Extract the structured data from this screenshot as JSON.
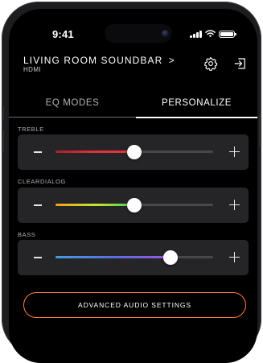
{
  "status_bar": {
    "time": "9:41",
    "icons": [
      "signal-icon",
      "wifi-icon",
      "battery-icon"
    ]
  },
  "header": {
    "device_name": "LIVING ROOM SOUNDBAR",
    "chevron": ">",
    "source": "HDMI",
    "icons": [
      "gear-icon",
      "exit-icon"
    ]
  },
  "tabs": [
    {
      "label": "EQ MODES",
      "active": false
    },
    {
      "label": "PERSONALIZE",
      "active": true
    }
  ],
  "sliders": [
    {
      "label": "TREBLE",
      "level": 0.5,
      "gradient": [
        "#a8222a",
        "#e0313a",
        "#e8343e"
      ]
    },
    {
      "label": "CLEARDIALOG",
      "level": 0.5,
      "gradient": [
        "#f0a020",
        "#c9e62a",
        "#3fd05a"
      ]
    },
    {
      "label": "BASS",
      "level": 0.73,
      "gradient": [
        "#3fa0e0",
        "#5a6de0",
        "#9a58e0"
      ]
    }
  ],
  "advanced_button": {
    "label": "ADVANCED AUDIO SETTINGS",
    "border_color": "#ff7a3c"
  }
}
